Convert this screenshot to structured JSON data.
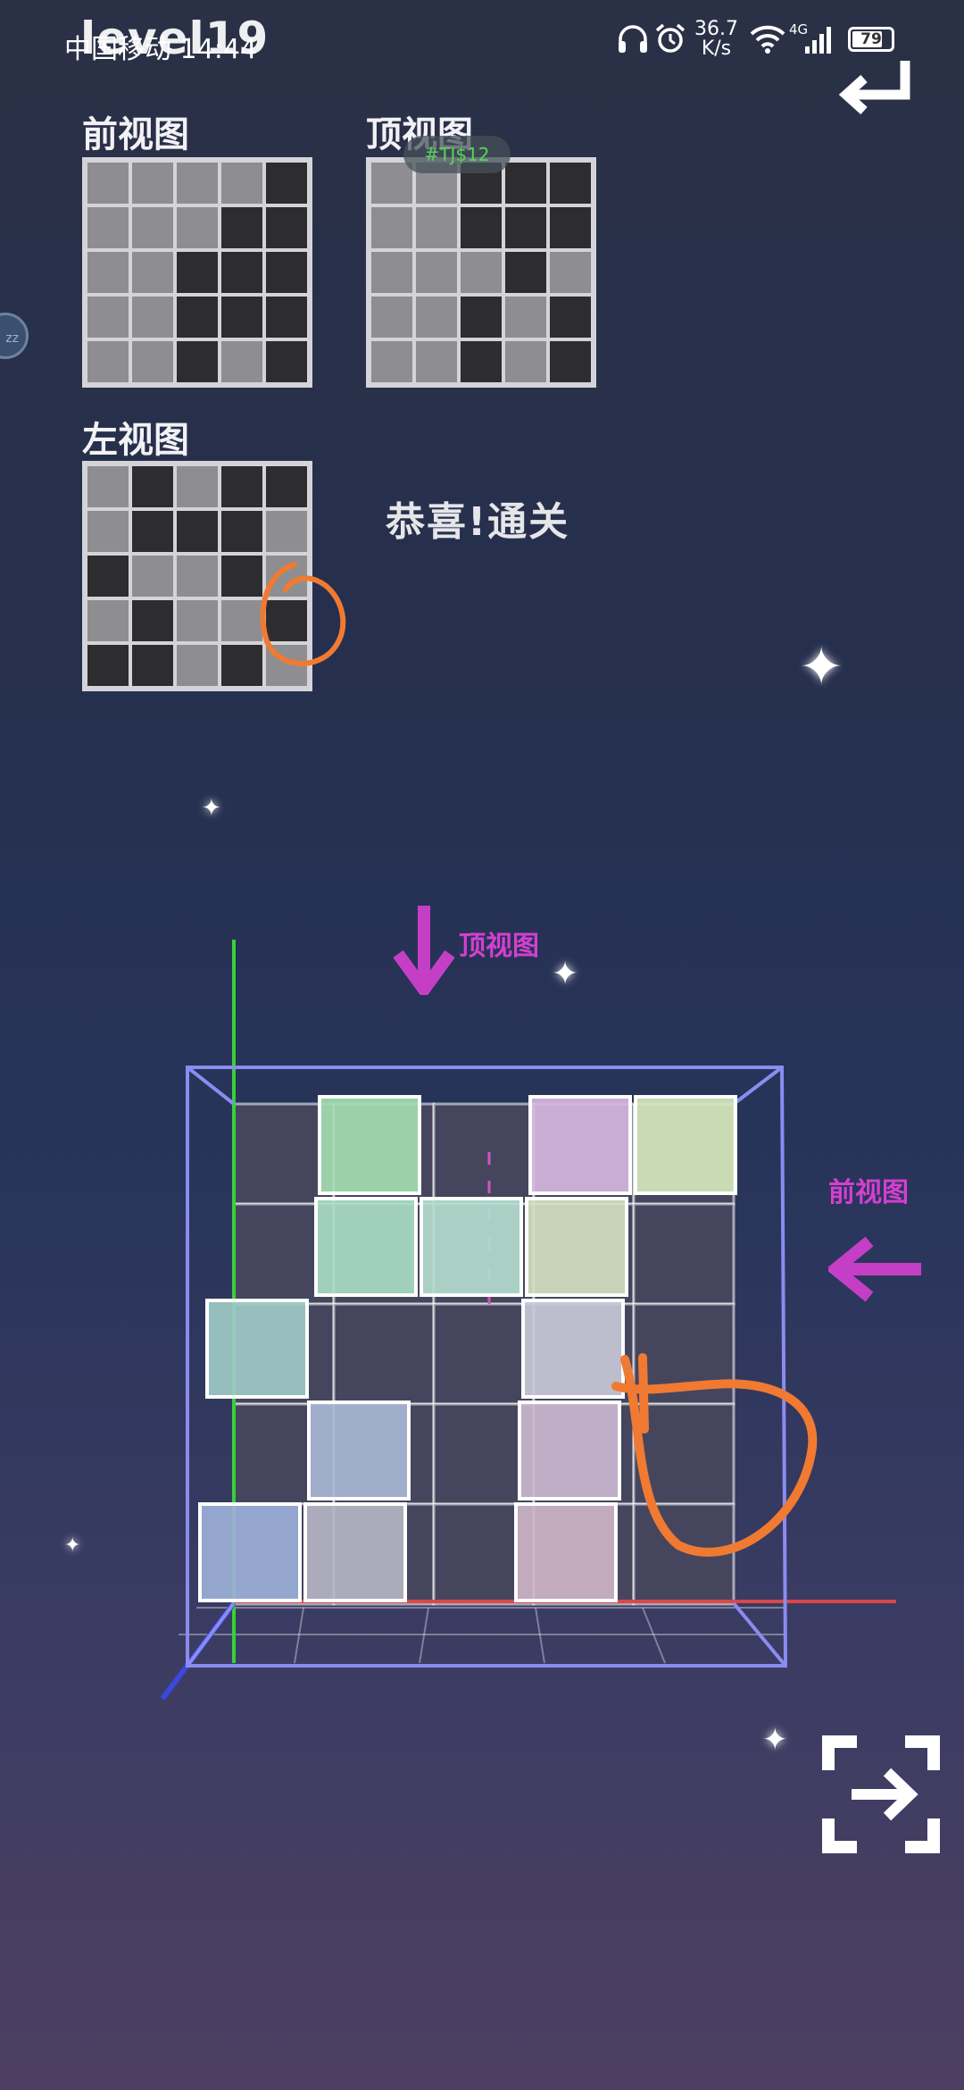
{
  "status_bar": {
    "carrier": "中国移动 14:44",
    "network_speed_value": "36.7",
    "network_speed_unit": "K/s",
    "network_type": "4G",
    "battery": "79",
    "battery_level": 0.79
  },
  "game": {
    "level_title": "level19",
    "solved_message": "恭喜!通关",
    "overlay_badge": "#TJ$12",
    "views": {
      "front": {
        "title": "前视图",
        "grid": [
          [
            0,
            0,
            0,
            0,
            1
          ],
          [
            0,
            0,
            0,
            1,
            1
          ],
          [
            0,
            0,
            1,
            1,
            1
          ],
          [
            0,
            0,
            1,
            1,
            1
          ],
          [
            0,
            0,
            1,
            0,
            1
          ]
        ]
      },
      "top": {
        "title": "顶视图",
        "grid": [
          [
            0,
            0,
            1,
            1,
            1
          ],
          [
            0,
            0,
            1,
            1,
            1
          ],
          [
            0,
            0,
            0,
            1,
            0
          ],
          [
            0,
            0,
            1,
            0,
            1
          ],
          [
            0,
            0,
            1,
            0,
            1
          ]
        ]
      },
      "left": {
        "title": "左视图",
        "grid": [
          [
            0,
            1,
            0,
            1,
            1
          ],
          [
            0,
            1,
            1,
            1,
            0
          ],
          [
            1,
            0,
            0,
            1,
            0
          ],
          [
            0,
            1,
            0,
            0,
            1
          ],
          [
            1,
            1,
            0,
            1,
            0
          ]
        ]
      }
    },
    "hints": {
      "top_arrow_label": "顶视图",
      "front_arrow_label": "前视图"
    },
    "scene": {
      "front_layer": [
        [
          null,
          "#a3dcb0",
          null,
          "#d7b6de",
          "#d6e7bd"
        ],
        [
          null,
          "#a8dcc6",
          "#b3dcce",
          "#d2dec0",
          null
        ],
        [
          "#9ecac6",
          null,
          null,
          "#c9c8d8",
          null
        ],
        [
          null,
          "#a8b7d6",
          null,
          "#c9b7cf",
          null
        ],
        [
          "#9cb0d8",
          "#b4b4c4",
          null,
          "#cdb4c6",
          null
        ]
      ],
      "axis_colors": {
        "x": "#d84848",
        "y": "#38d038",
        "z": "#3a48e0"
      },
      "box_color": "#8a8cf0"
    }
  }
}
